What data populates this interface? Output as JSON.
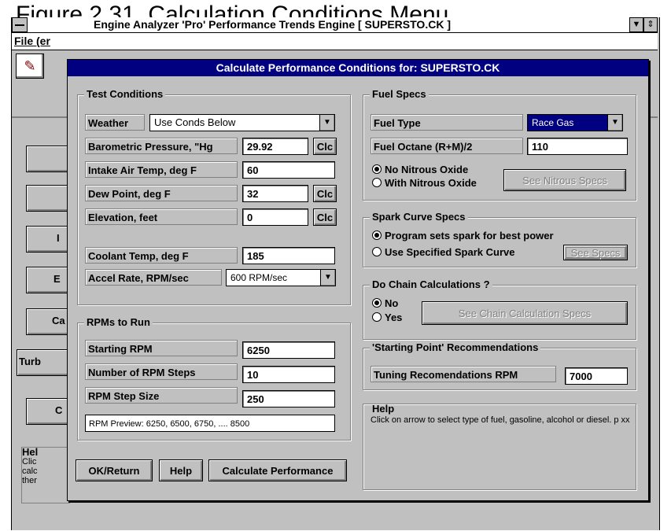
{
  "figure_caption": "Figure 2.31, Calculation Conditions Menu",
  "app_window": {
    "title": "Engine Analyzer 'Pro'   Performance Trends    Engine [ SUPERSTO.CK ]",
    "menu_first": "File (er",
    "side_button_partials": [
      "",
      "",
      "I",
      "E",
      "Ca",
      "Turb",
      "C"
    ],
    "help_partial": [
      "Hel",
      "Clic",
      "calc",
      "ther"
    ]
  },
  "dialog": {
    "title": "Calculate Performance Conditions for: SUPERSTO.CK",
    "test_conditions": {
      "group_title": "Test Conditions",
      "weather_label": "Weather",
      "weather_value": "Use Conds Below",
      "baro_label": "Barometric Pressure, \"Hg",
      "baro_value": "29.92",
      "intake_label": "Intake Air Temp, deg F",
      "intake_value": "60",
      "dew_label": "Dew Point, deg F",
      "dew_value": "32",
      "elev_label": "Elevation, feet",
      "elev_value": "0",
      "coolant_label": "Coolant Temp, deg F",
      "coolant_value": "185",
      "accel_label": "Accel Rate, RPM/sec",
      "accel_value": "600 RPM/sec",
      "clc": "Clc"
    },
    "rpms": {
      "group_title": "RPMs to Run",
      "start_label": "Starting RPM",
      "start_value": "6250",
      "steps_label": "Number of RPM Steps",
      "steps_value": "10",
      "size_label": "RPM Step Size",
      "size_value": "250",
      "preview": "RPM Preview: 6250, 6500, 6750, .... 8500"
    },
    "buttons": {
      "ok": "OK/Return",
      "help": "Help",
      "calculate": "Calculate Performance"
    },
    "fuel": {
      "group_title": "Fuel Specs",
      "type_label": "Fuel Type",
      "type_value": "Race Gas",
      "octane_label": "Fuel Octane (R+M)/2",
      "octane_value": "110",
      "no_nitrous": "No Nitrous Oxide",
      "with_nitrous": "With Nitrous Oxide",
      "see_nitrous": "See Nitrous Specs"
    },
    "spark": {
      "group_title": "Spark Curve Specs",
      "opt1": "Program sets spark for best power",
      "opt2": "Use Specified Spark Curve",
      "see_specs": "See Specs"
    },
    "chain": {
      "group_title": "Do Chain Calculations ?",
      "no": "No",
      "yes": "Yes",
      "see_chain": "See Chain Calculation Specs"
    },
    "starting_point": {
      "group_title": "'Starting Point' Recommendations",
      "label": "Tuning Recomendations RPM",
      "value": "7000"
    },
    "help": {
      "group_title": "Help",
      "text": "Click on arrow to select type of fuel, gasoline, alcohol or diesel.  p xx"
    }
  }
}
